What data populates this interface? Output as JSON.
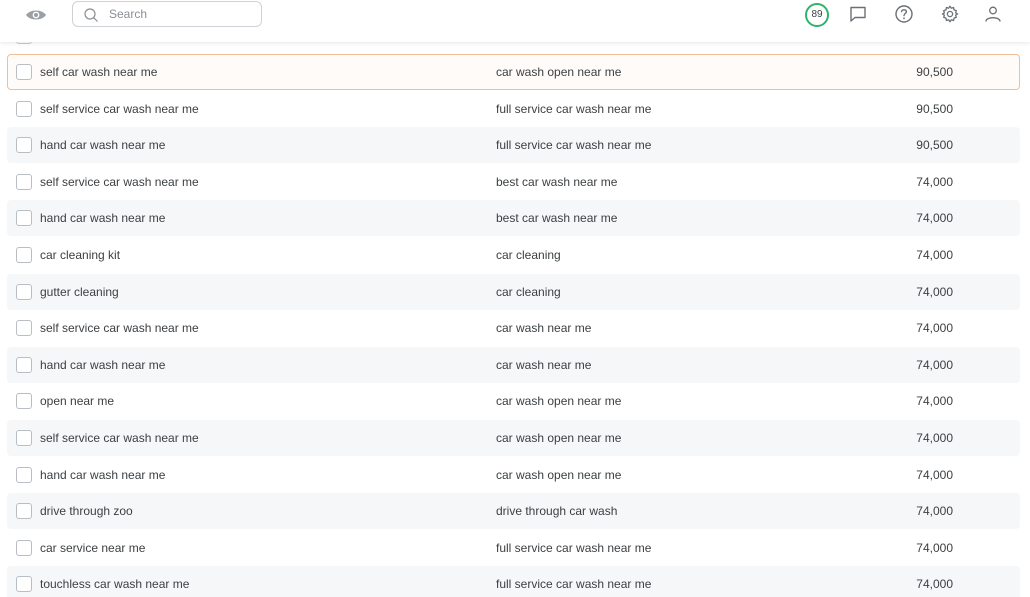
{
  "header": {
    "search_placeholder": "Search",
    "score": "89",
    "score_color": "#2fb36b",
    "icons": [
      "eye-icon",
      "search-icon",
      "comment-icon",
      "help-icon",
      "gear-icon",
      "user-icon"
    ]
  },
  "rows": [
    {
      "keyword": "self car wash near me",
      "related": "car wash open near me",
      "volume": "90,500",
      "selected": true
    },
    {
      "keyword": "self service car wash near me",
      "related": "full service car wash near me",
      "volume": "90,500"
    },
    {
      "keyword": "hand car wash near me",
      "related": "full service car wash near me",
      "volume": "90,500"
    },
    {
      "keyword": "self service car wash near me",
      "related": "best car wash near me",
      "volume": "74,000"
    },
    {
      "keyword": "hand car wash near me",
      "related": "best car wash near me",
      "volume": "74,000"
    },
    {
      "keyword": "car cleaning kit",
      "related": "car cleaning",
      "volume": "74,000"
    },
    {
      "keyword": "gutter cleaning",
      "related": "car cleaning",
      "volume": "74,000"
    },
    {
      "keyword": "self service car wash near me",
      "related": "car wash near me",
      "volume": "74,000"
    },
    {
      "keyword": "hand car wash near me",
      "related": "car wash near me",
      "volume": "74,000"
    },
    {
      "keyword": "open near me",
      "related": "car wash open near me",
      "volume": "74,000"
    },
    {
      "keyword": "self service car wash near me",
      "related": "car wash open near me",
      "volume": "74,000"
    },
    {
      "keyword": "hand car wash near me",
      "related": "car wash open near me",
      "volume": "74,000"
    },
    {
      "keyword": "drive through zoo",
      "related": "drive through car wash",
      "volume": "74,000"
    },
    {
      "keyword": "car service near me",
      "related": "full service car wash near me",
      "volume": "74,000"
    },
    {
      "keyword": "touchless car wash near me",
      "related": "full service car wash near me",
      "volume": "74,000"
    }
  ]
}
